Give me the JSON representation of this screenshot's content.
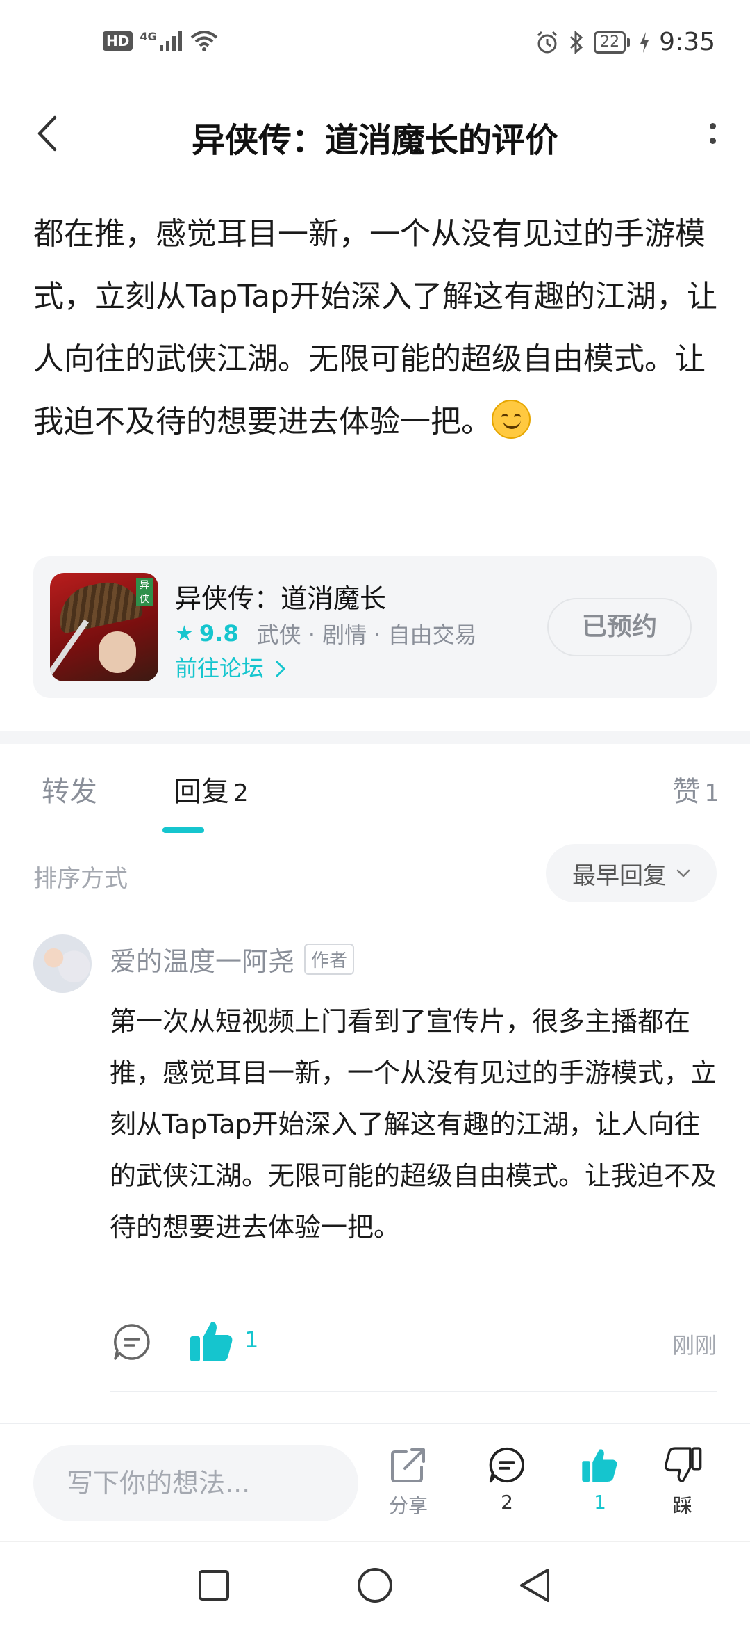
{
  "status_bar": {
    "network_badge": "HD",
    "network_type": "4G",
    "battery_level": "22",
    "time": "9:35"
  },
  "header": {
    "title": "异侠传：道消魔长的评价",
    "back_icon": "chevron-left-icon",
    "more_icon": "more-vertical-icon"
  },
  "review": {
    "text": "都在推，感觉耳目一新，一个从没有见过的手游模式，立刻从TapTap开始深入了解这有趣的江湖，让人向往的武侠江湖。无限可能的超级自由模式。让我迫不及待的想要进去体验一把。"
  },
  "game_card": {
    "name": "异侠传：道消魔长",
    "rating": "9.8",
    "tags": "武侠 · 剧情 · 自由交易",
    "forum_link": "前往论坛",
    "action_button": "已预约",
    "accent_color": "#15c5ce"
  },
  "tabs": {
    "forward": {
      "label": "转发"
    },
    "reply": {
      "label": "回复",
      "count": "2"
    },
    "likes": {
      "label": "赞",
      "count": "1"
    }
  },
  "sort": {
    "label": "排序方式",
    "selected": "最早回复"
  },
  "comment": {
    "user": "爱的温度一阿尧",
    "tag": "作者",
    "text": "第一次从短视频上门看到了宣传片，很多主播都在推，感觉耳目一新，一个从没有见过的手游模式，立刻从TapTap开始深入了解这有趣的江湖，让人向往的武侠江湖。无限可能的超级自由模式。让我迫不及待的想要进去体验一把。",
    "likes": "1",
    "time": "刚刚"
  },
  "bottom_bar": {
    "input_placeholder": "写下你的想法...",
    "share_label": "分享",
    "comment_count": "2",
    "like_count": "1",
    "dislike_label": "踩"
  }
}
